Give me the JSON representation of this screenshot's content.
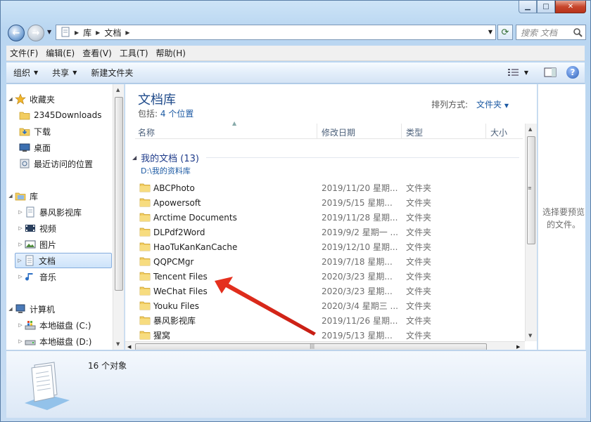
{
  "address": {
    "segments": [
      "库",
      "文档"
    ]
  },
  "search": {
    "placeholder": "搜索 文档"
  },
  "menu": [
    "文件(F)",
    "编辑(E)",
    "查看(V)",
    "工具(T)",
    "帮助(H)"
  ],
  "toolbar": {
    "organize": "组织",
    "share": "共享",
    "new_folder": "新建文件夹"
  },
  "nav": {
    "favorites": "收藏夹",
    "fav_items": [
      "2345Downloads",
      "下载",
      "桌面",
      "最近访问的位置"
    ],
    "libraries": "库",
    "lib_items": [
      "暴风影视库",
      "视频",
      "图片",
      "文档",
      "音乐"
    ],
    "computer": "计算机",
    "drives": [
      "本地磁盘 (C:)",
      "本地磁盘 (D:)"
    ]
  },
  "library": {
    "title": "文档库",
    "includes_label": "包括:",
    "includes_link": "4 个位置",
    "sort_label": "排列方式:",
    "sort_value": "文件夹"
  },
  "columns": [
    "名称",
    "修改日期",
    "类型",
    "大小"
  ],
  "group": {
    "title": "我的文档 (13)",
    "path": "D:\\我的资料库"
  },
  "files": [
    {
      "name": "ABCPhoto",
      "date": "2019/11/20 星期...",
      "type": "文件夹"
    },
    {
      "name": "Apowersoft",
      "date": "2019/5/15 星期...",
      "type": "文件夹"
    },
    {
      "name": "Arctime Documents",
      "date": "2019/11/28 星期...",
      "type": "文件夹"
    },
    {
      "name": "DLPdf2Word",
      "date": "2019/9/2 星期一 ...",
      "type": "文件夹"
    },
    {
      "name": "HaoTuKanKanCache",
      "date": "2019/12/10 星期...",
      "type": "文件夹"
    },
    {
      "name": "QQPCMgr",
      "date": "2019/7/18 星期...",
      "type": "文件夹"
    },
    {
      "name": "Tencent Files",
      "date": "2020/3/23 星期...",
      "type": "文件夹"
    },
    {
      "name": "WeChat Files",
      "date": "2020/3/23 星期...",
      "type": "文件夹"
    },
    {
      "name": "Youku Files",
      "date": "2020/3/4 星期三 ...",
      "type": "文件夹"
    },
    {
      "name": "暴风影视库",
      "date": "2019/11/26 星期...",
      "type": "文件夹"
    },
    {
      "name": "猩窝",
      "date": "2019/5/13 星期...",
      "type": "文件夹"
    }
  ],
  "preview": {
    "text": "选择要预览的文件。"
  },
  "details": {
    "count": "16 个对象"
  },
  "colors": {
    "accent": "#1c5aa3",
    "annotation_arrow": "#d9261c"
  }
}
